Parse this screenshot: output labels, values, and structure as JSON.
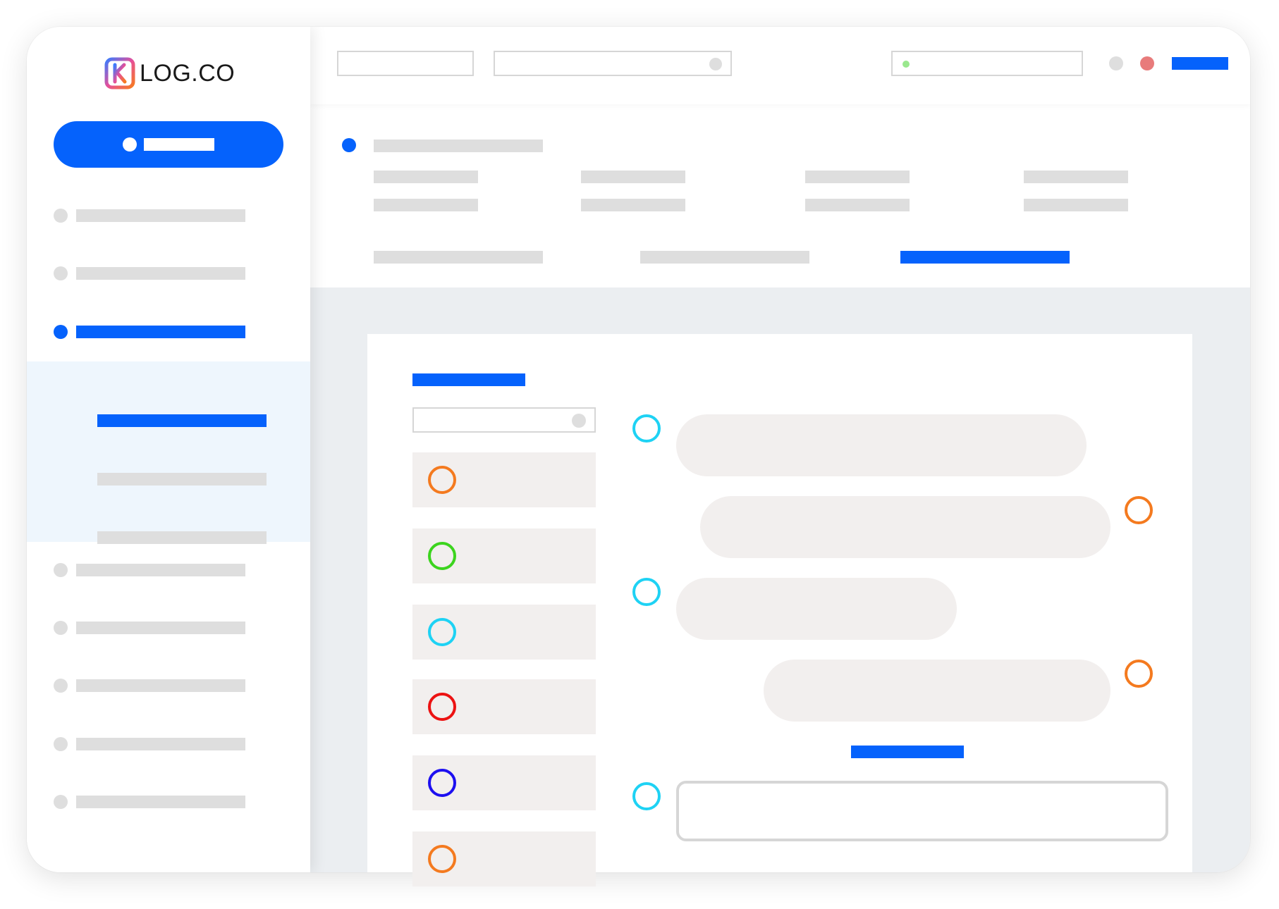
{
  "brand": {
    "logo_letter": "K",
    "logo_text": "LOG.CO",
    "colors": {
      "accent": "#0562fc",
      "placeholder": "#dedede",
      "panel": "#f2efee",
      "submenu_bg": "#eef6fd",
      "main_bg": "#ebeef1"
    }
  },
  "sidebar": {
    "primary_button_icon": "circle-icon",
    "nav_active_index": 2,
    "submenu_active_index": 0
  },
  "topbar": {
    "status_color": "#9ae88e",
    "notification_color": "#e87b7b"
  },
  "contacts": [
    {
      "ring_color": "#f47a1f"
    },
    {
      "ring_color": "#3cd41e"
    },
    {
      "ring_color": "#1ed2f4"
    },
    {
      "ring_color": "#ec1212"
    },
    {
      "ring_color": "#1d0ff0"
    },
    {
      "ring_color": "#f47a1f"
    }
  ],
  "messages": [
    {
      "side": "left",
      "avatar_color": "#1ed2f4"
    },
    {
      "side": "right",
      "avatar_color": "#f47a1f"
    },
    {
      "side": "left",
      "avatar_color": "#1ed2f4"
    },
    {
      "side": "right",
      "avatar_color": "#f47a1f"
    }
  ],
  "composer": {
    "avatar_color": "#1ed2f4"
  }
}
